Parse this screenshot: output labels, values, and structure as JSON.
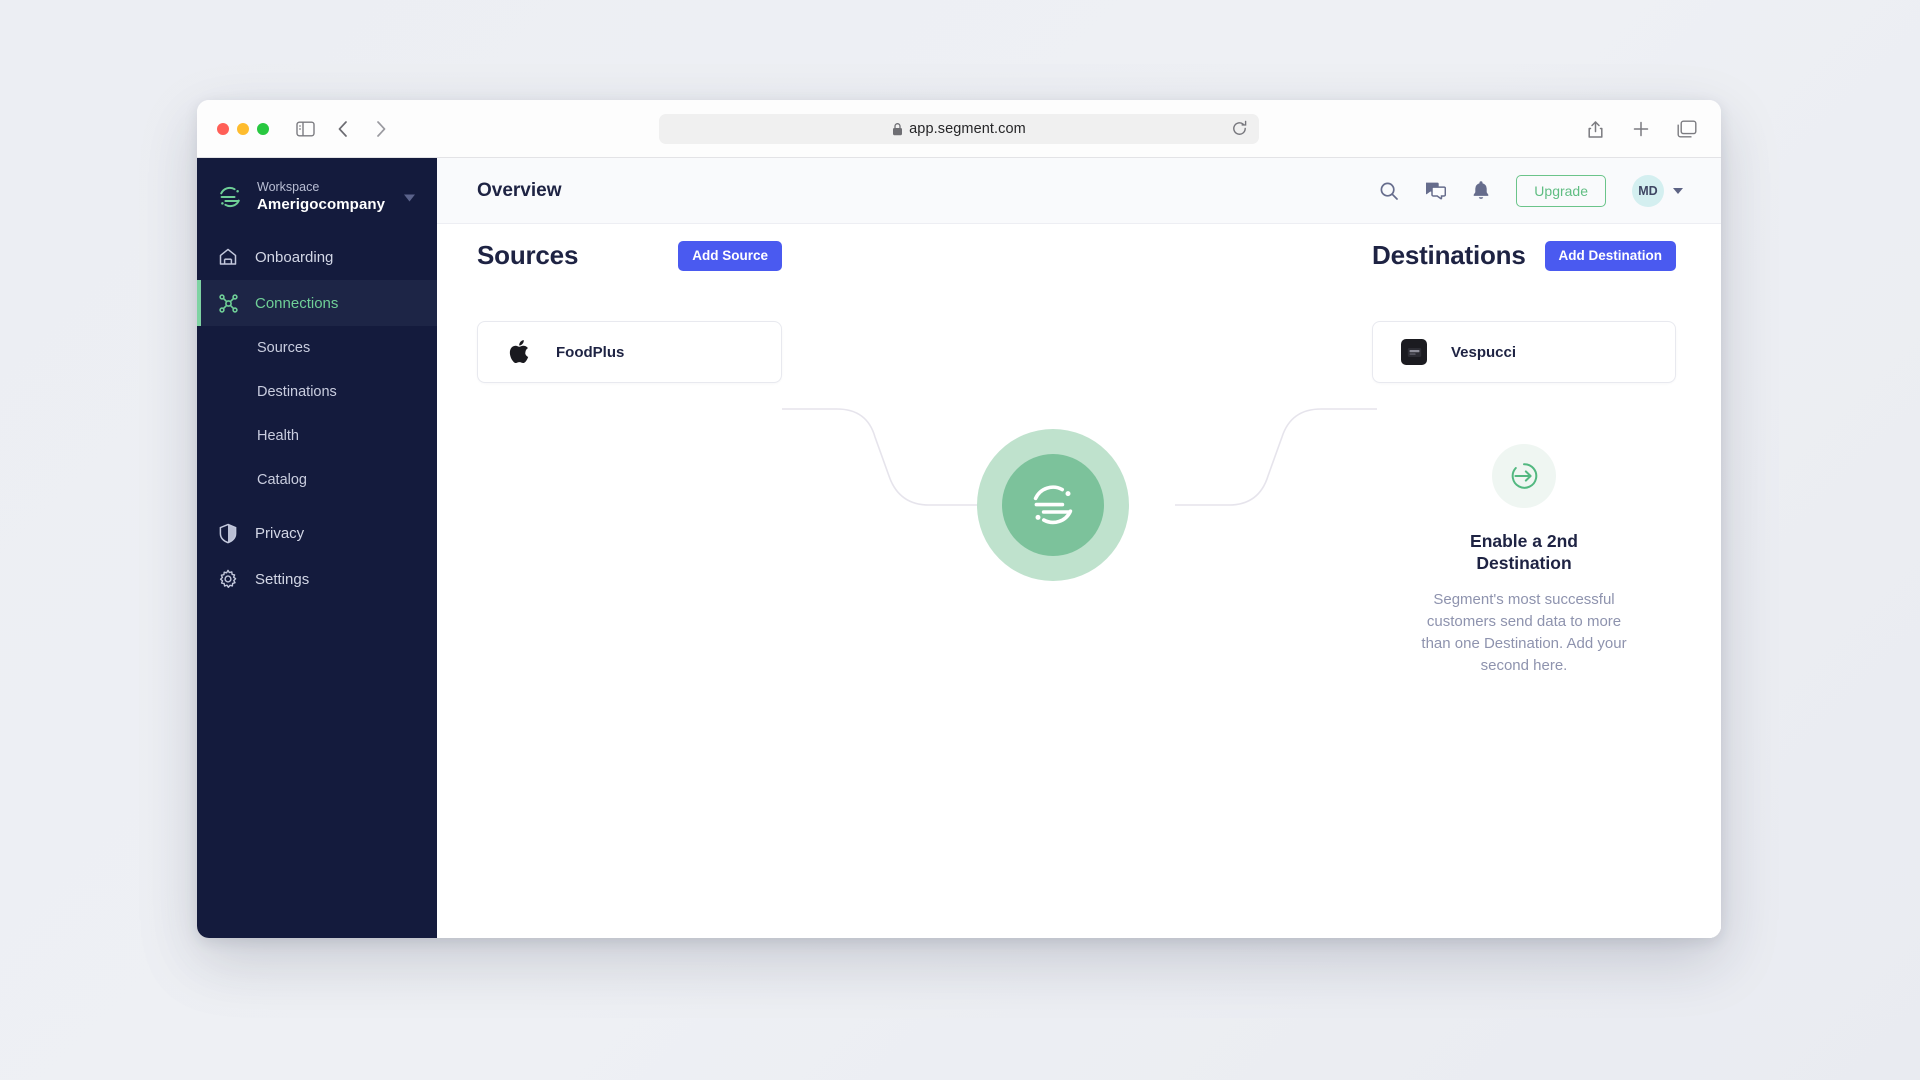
{
  "browser": {
    "url": "app.segment.com",
    "icons": {
      "sidebar_toggle": "sidebar-toggle-icon",
      "back": "back-chevron-icon",
      "forward": "forward-chevron-icon",
      "shield": "privacy-shield-icon",
      "lock": "lock-icon",
      "reload": "reload-icon",
      "share": "share-icon",
      "new_tab": "plus-icon",
      "tabs": "tabs-icon"
    }
  },
  "sidebar": {
    "workspace_label": "Workspace",
    "workspace_name": "Amerigocompany",
    "items": [
      {
        "label": "Onboarding",
        "icon": "home-icon",
        "active": false
      },
      {
        "label": "Connections",
        "icon": "connections-icon",
        "active": true
      }
    ],
    "sub_items": [
      {
        "label": "Sources"
      },
      {
        "label": "Destinations"
      },
      {
        "label": "Health"
      },
      {
        "label": "Catalog"
      }
    ],
    "bottom_items": [
      {
        "label": "Privacy",
        "icon": "shield-icon"
      },
      {
        "label": "Settings",
        "icon": "gear-icon"
      }
    ],
    "accent_color": "#6fcf97",
    "background_color": "#141b3d"
  },
  "header": {
    "title": "Overview",
    "upgrade_label": "Upgrade",
    "avatar_initials": "MD",
    "icons": {
      "search": "search-icon",
      "chat": "chat-icon",
      "bell": "bell-icon",
      "caret": "chevron-down-icon"
    }
  },
  "sources": {
    "title": "Sources",
    "add_label": "Add Source",
    "items": [
      {
        "name": "FoodPlus",
        "icon": "apple-icon"
      }
    ]
  },
  "destinations": {
    "title": "Destinations",
    "add_label": "Add Destination",
    "items": [
      {
        "name": "Vespucci",
        "icon": "vespucci-icon"
      }
    ]
  },
  "hub": {
    "icon": "segment-logo-icon",
    "outer_color": "#bfe2cd",
    "inner_color": "#7cc29b"
  },
  "promo": {
    "icon": "enter-arrow-icon",
    "title": "Enable a 2nd Destination",
    "body": "Segment's most successful customers send data to more than one Destination. Add your second here."
  },
  "colors": {
    "primary_button": "#4a5af0",
    "upgrade_outline": "#6bc48a",
    "text_dark": "#1e2343"
  }
}
